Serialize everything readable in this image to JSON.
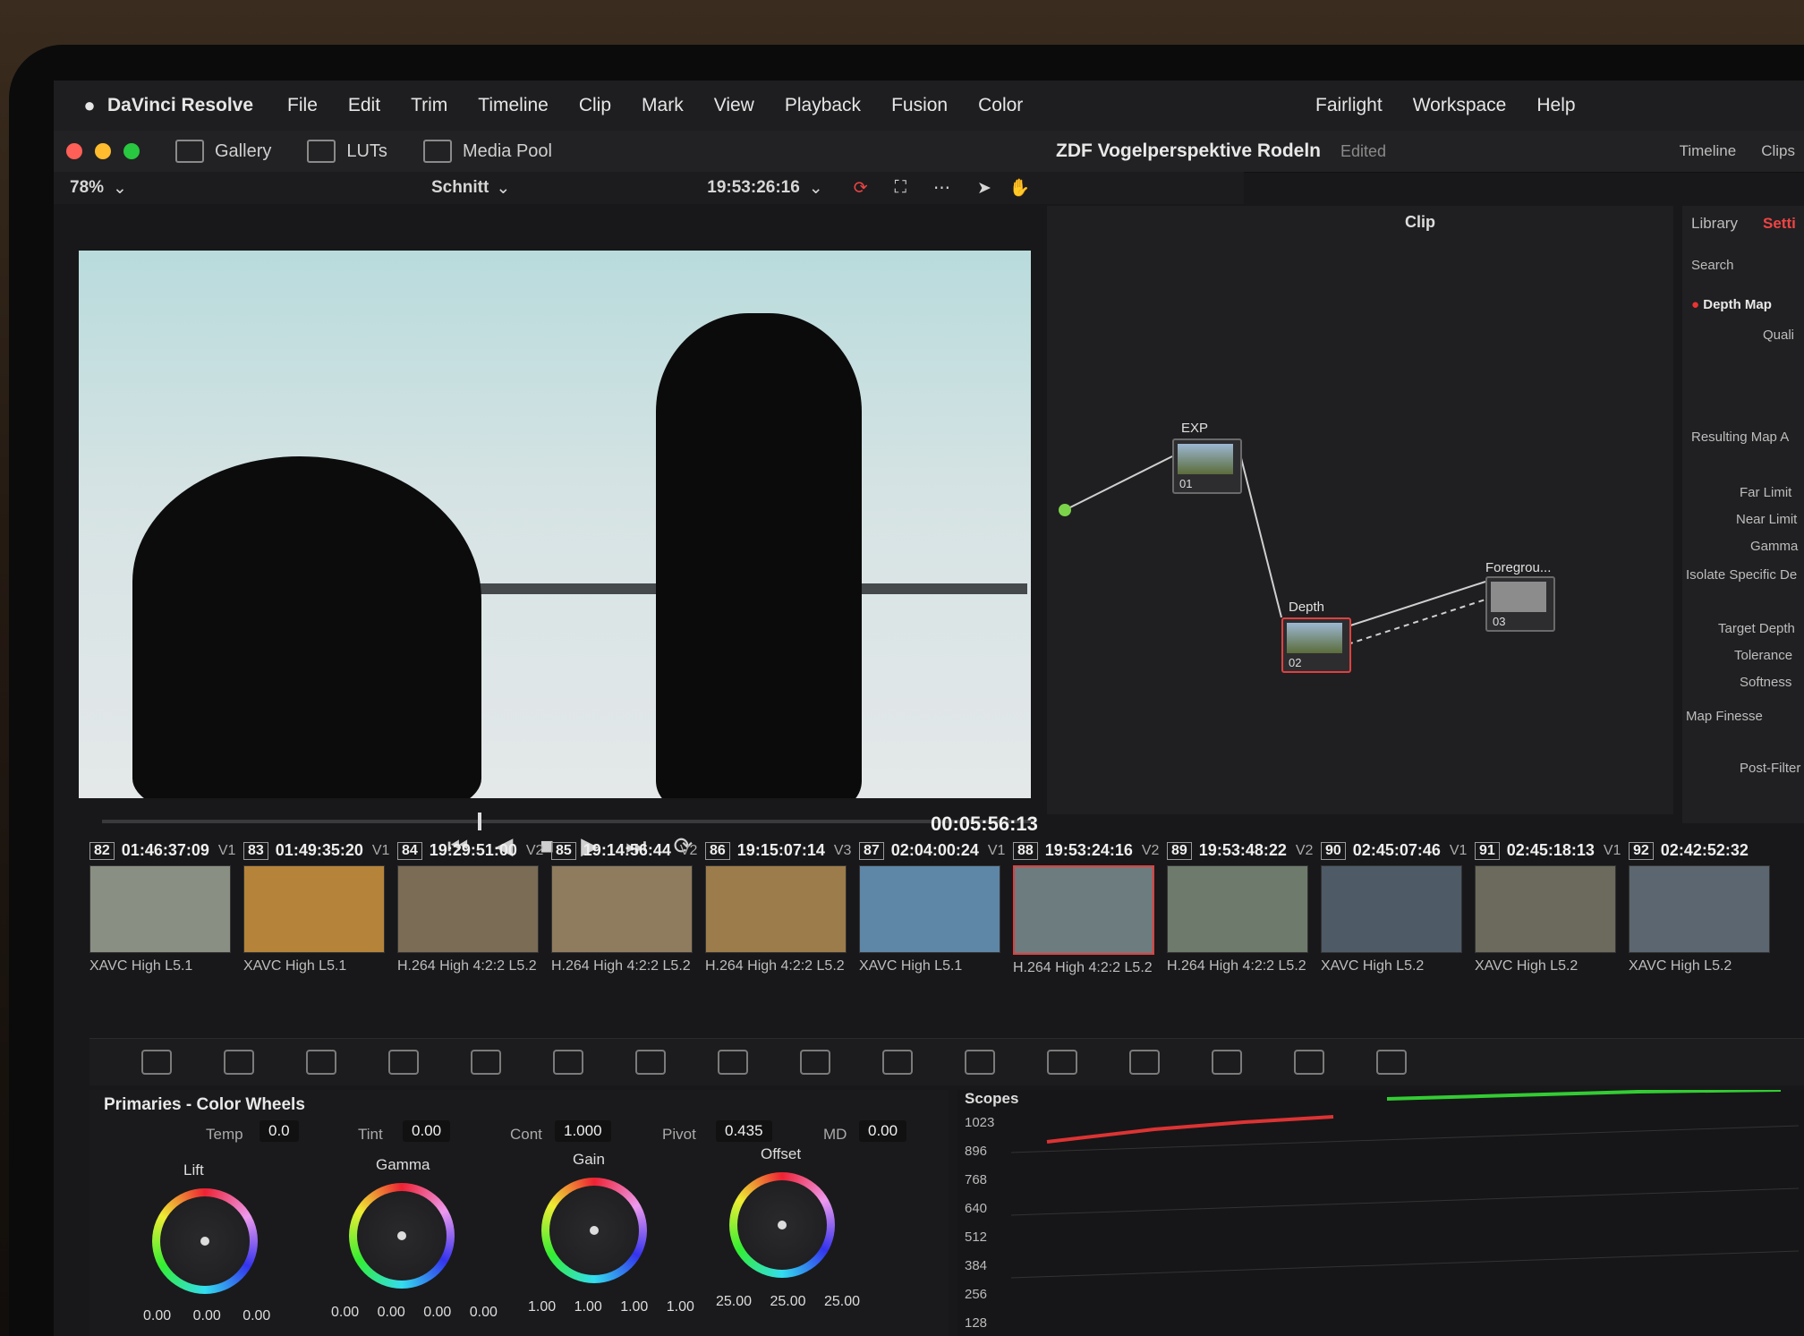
{
  "menubar": {
    "app": "DaVinci Resolve",
    "items": [
      "File",
      "Edit",
      "Trim",
      "Timeline",
      "Clip",
      "Mark",
      "View",
      "Playback",
      "Fusion",
      "Color"
    ],
    "right_items": [
      "Fairlight",
      "Workspace",
      "Help"
    ]
  },
  "toolbar": {
    "gallery": "Gallery",
    "luts": "LUTs",
    "media_pool": "Media Pool",
    "project_title": "ZDF Vogelperspektive Rodeln",
    "status": "Edited",
    "timeline": "Timeline",
    "clips": "Clips"
  },
  "viewer": {
    "zoom": "78%",
    "timeline_name": "Schnitt",
    "timecode": "19:53:26:16",
    "duration": "00:05:56:13"
  },
  "nodes": {
    "mode": "Clip",
    "items": [
      {
        "name": "EXP",
        "label": "01"
      },
      {
        "name": "Depth",
        "label": "02"
      },
      {
        "name": "Foregrou...",
        "label": "03"
      }
    ]
  },
  "sidepanel": {
    "tab_library": "Library",
    "tab_settings": "Setti",
    "search": "Search",
    "effect": "Depth Map",
    "qual": "Quali",
    "section_resulting": "Resulting Map A",
    "far_limit": "Far Limit",
    "near_limit": "Near Limit",
    "gamma": "Gamma",
    "section_isolate": "Isolate Specific De",
    "target_depth": "Target Depth",
    "tolerance": "Tolerance",
    "softness": "Softness",
    "section_finesse": "Map Finesse",
    "post_filter": "Post-Filter"
  },
  "clips": [
    {
      "num": "82",
      "tc": "01:46:37:09",
      "track": "V1",
      "codec": "XAVC High L5.1",
      "color": "#8a8f83"
    },
    {
      "num": "83",
      "tc": "01:49:35:20",
      "track": "V1",
      "codec": "XAVC High L5.1",
      "color": "#b5843a"
    },
    {
      "num": "84",
      "tc": "19:29:51:00",
      "track": "V2",
      "codec": "H.264 High 4:2:2 L5.2",
      "color": "#7a6c55"
    },
    {
      "num": "85",
      "tc": "19:14:56:44",
      "track": "V2",
      "codec": "H.264 High 4:2:2 L5.2",
      "color": "#8f7b5e"
    },
    {
      "num": "86",
      "tc": "19:15:07:14",
      "track": "V3",
      "codec": "H.264 High 4:2:2 L5.2",
      "color": "#9c7c4a"
    },
    {
      "num": "87",
      "tc": "02:04:00:24",
      "track": "V1",
      "codec": "XAVC High L5.1",
      "color": "#5e86a6"
    },
    {
      "num": "88",
      "tc": "19:53:24:16",
      "track": "V2",
      "codec": "H.264 High 4:2:2 L5.2",
      "color": "#6d7c7e"
    },
    {
      "num": "89",
      "tc": "19:53:48:22",
      "track": "V2",
      "codec": "H.264 High 4:2:2 L5.2",
      "color": "#6e7a6c"
    },
    {
      "num": "90",
      "tc": "02:45:07:46",
      "track": "V1",
      "codec": "XAVC High L5.2",
      "color": "#4e5a66"
    },
    {
      "num": "91",
      "tc": "02:45:18:13",
      "track": "V1",
      "codec": "XAVC High L5.2",
      "color": "#6c6a5c"
    },
    {
      "num": "92",
      "tc": "02:42:52:32",
      "track": "",
      "codec": "XAVC High L5.2",
      "color": "#5c6670"
    }
  ],
  "colorwheels": {
    "title": "Primaries - Color Wheels",
    "temp_label": "Temp",
    "temp": "0.0",
    "tint_label": "Tint",
    "tint": "0.00",
    "cont_label": "Cont",
    "cont": "1.000",
    "pivot_label": "Pivot",
    "pivot": "0.435",
    "md_label": "MD",
    "md": "0.00",
    "wheels": [
      {
        "name": "Lift",
        "values": [
          "0.00",
          "0.00",
          "0.00"
        ]
      },
      {
        "name": "Gamma",
        "values": [
          "0.00",
          "0.00",
          "0.00",
          "0.00"
        ]
      },
      {
        "name": "Gain",
        "values": [
          "1.00",
          "1.00",
          "1.00",
          "1.00"
        ]
      },
      {
        "name": "Offset",
        "values": [
          "25.00",
          "25.00",
          "25.00"
        ]
      }
    ]
  },
  "scopes": {
    "title": "Scopes",
    "axis": [
      "1023",
      "896",
      "768",
      "640",
      "512",
      "384",
      "256",
      "128"
    ]
  }
}
